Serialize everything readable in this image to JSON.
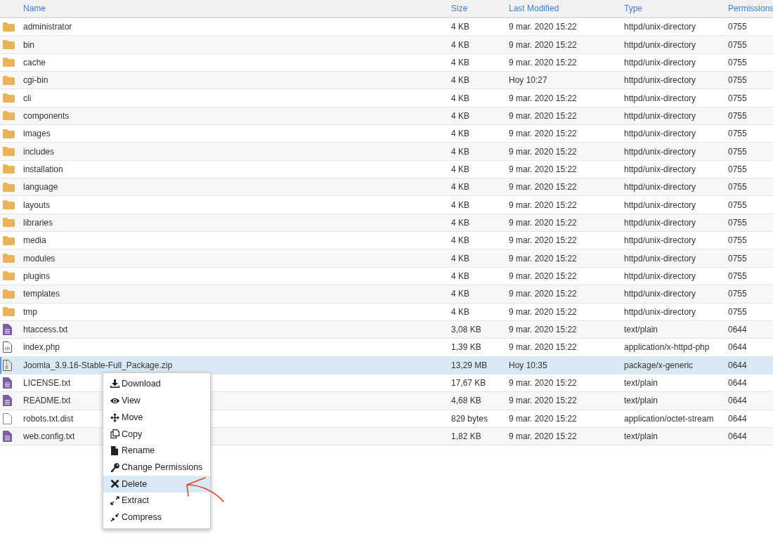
{
  "columns": [
    "Name",
    "Size",
    "Last Modified",
    "Type",
    "Permissions"
  ],
  "rows": [
    {
      "kind": "folder",
      "name": "administrator",
      "size": "4 KB",
      "modified": "9 mar. 2020 15:22",
      "type": "httpd/unix-directory",
      "permissions": "0755",
      "selected": false
    },
    {
      "kind": "folder",
      "name": "bin",
      "size": "4 KB",
      "modified": "9 mar. 2020 15:22",
      "type": "httpd/unix-directory",
      "permissions": "0755",
      "selected": false
    },
    {
      "kind": "folder",
      "name": "cache",
      "size": "4 KB",
      "modified": "9 mar. 2020 15:22",
      "type": "httpd/unix-directory",
      "permissions": "0755",
      "selected": false
    },
    {
      "kind": "folder",
      "name": "cgi-bin",
      "size": "4 KB",
      "modified": "Hoy 10:27",
      "type": "httpd/unix-directory",
      "permissions": "0755",
      "selected": false
    },
    {
      "kind": "folder",
      "name": "cli",
      "size": "4 KB",
      "modified": "9 mar. 2020 15:22",
      "type": "httpd/unix-directory",
      "permissions": "0755",
      "selected": false
    },
    {
      "kind": "folder",
      "name": "components",
      "size": "4 KB",
      "modified": "9 mar. 2020 15:22",
      "type": "httpd/unix-directory",
      "permissions": "0755",
      "selected": false
    },
    {
      "kind": "folder",
      "name": "images",
      "size": "4 KB",
      "modified": "9 mar. 2020 15:22",
      "type": "httpd/unix-directory",
      "permissions": "0755",
      "selected": false
    },
    {
      "kind": "folder",
      "name": "includes",
      "size": "4 KB",
      "modified": "9 mar. 2020 15:22",
      "type": "httpd/unix-directory",
      "permissions": "0755",
      "selected": false
    },
    {
      "kind": "folder",
      "name": "installation",
      "size": "4 KB",
      "modified": "9 mar. 2020 15:22",
      "type": "httpd/unix-directory",
      "permissions": "0755",
      "selected": false
    },
    {
      "kind": "folder",
      "name": "language",
      "size": "4 KB",
      "modified": "9 mar. 2020 15:22",
      "type": "httpd/unix-directory",
      "permissions": "0755",
      "selected": false
    },
    {
      "kind": "folder",
      "name": "layouts",
      "size": "4 KB",
      "modified": "9 mar. 2020 15:22",
      "type": "httpd/unix-directory",
      "permissions": "0755",
      "selected": false
    },
    {
      "kind": "folder",
      "name": "libraries",
      "size": "4 KB",
      "modified": "9 mar. 2020 15:22",
      "type": "httpd/unix-directory",
      "permissions": "0755",
      "selected": false
    },
    {
      "kind": "folder",
      "name": "media",
      "size": "4 KB",
      "modified": "9 mar. 2020 15:22",
      "type": "httpd/unix-directory",
      "permissions": "0755",
      "selected": false
    },
    {
      "kind": "folder",
      "name": "modules",
      "size": "4 KB",
      "modified": "9 mar. 2020 15:22",
      "type": "httpd/unix-directory",
      "permissions": "0755",
      "selected": false
    },
    {
      "kind": "folder",
      "name": "plugins",
      "size": "4 KB",
      "modified": "9 mar. 2020 15:22",
      "type": "httpd/unix-directory",
      "permissions": "0755",
      "selected": false
    },
    {
      "kind": "folder",
      "name": "templates",
      "size": "4 KB",
      "modified": "9 mar. 2020 15:22",
      "type": "httpd/unix-directory",
      "permissions": "0755",
      "selected": false
    },
    {
      "kind": "folder",
      "name": "tmp",
      "size": "4 KB",
      "modified": "9 mar. 2020 15:22",
      "type": "httpd/unix-directory",
      "permissions": "0755",
      "selected": false
    },
    {
      "kind": "text",
      "name": "htaccess.txt",
      "size": "3,08 KB",
      "modified": "9 mar. 2020 15:22",
      "type": "text/plain",
      "permissions": "0644",
      "selected": false
    },
    {
      "kind": "code",
      "name": "index.php",
      "size": "1,39 KB",
      "modified": "9 mar. 2020 15:22",
      "type": "application/x-httpd-php",
      "permissions": "0644",
      "selected": false
    },
    {
      "kind": "archive",
      "name": "Joomla_3.9.16-Stable-Full_Package.zip",
      "size": "13,29 MB",
      "modified": "Hoy 10:35",
      "type": "package/x-generic",
      "permissions": "0644",
      "selected": true
    },
    {
      "kind": "text",
      "name": "LICENSE.txt",
      "size": "17,67 KB",
      "modified": "9 mar. 2020 15:22",
      "type": "text/plain",
      "permissions": "0644",
      "selected": false
    },
    {
      "kind": "text",
      "name": "README.txt",
      "size": "4,68 KB",
      "modified": "9 mar. 2020 15:22",
      "type": "text/plain",
      "permissions": "0644",
      "selected": false
    },
    {
      "kind": "file",
      "name": "robots.txt.dist",
      "size": "829 bytes",
      "modified": "9 mar. 2020 15:22",
      "type": "application/octet-stream",
      "permissions": "0644",
      "selected": false
    },
    {
      "kind": "text",
      "name": "web.config.txt",
      "size": "1,82 KB",
      "modified": "9 mar. 2020 15:22",
      "type": "text/plain",
      "permissions": "0644",
      "selected": false
    }
  ],
  "context_menu": {
    "items": [
      {
        "label": "Download",
        "selected": false
      },
      {
        "label": "View",
        "selected": false
      },
      {
        "label": "Move",
        "selected": false
      },
      {
        "label": "Copy",
        "selected": false
      },
      {
        "label": "Rename",
        "selected": false
      },
      {
        "label": "Change Permissions",
        "selected": false
      },
      {
        "label": "Delete",
        "selected": true
      },
      {
        "label": "Extract",
        "selected": false
      },
      {
        "label": "Compress",
        "selected": false
      }
    ]
  }
}
